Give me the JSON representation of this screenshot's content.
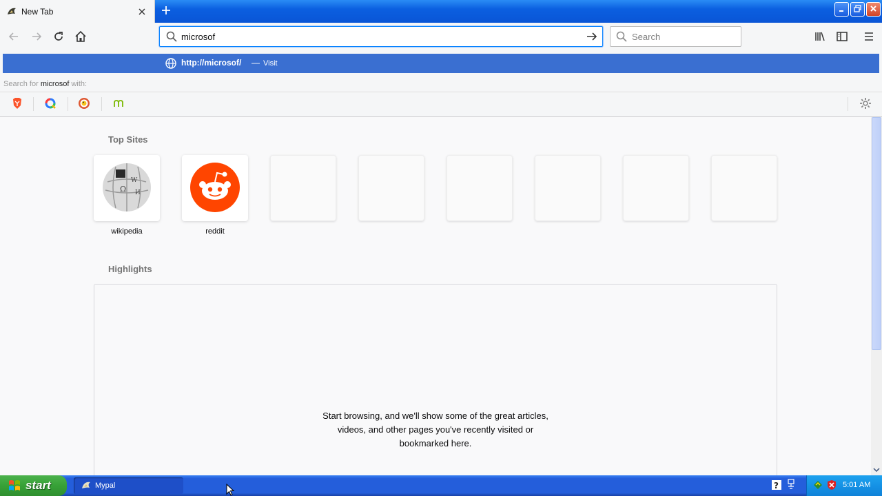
{
  "browser": {
    "tab": {
      "title": "New Tab",
      "favicon": "mypal-icon"
    },
    "new_tab_icon": "plus-icon",
    "window_controls": [
      "minimize-icon",
      "restore-icon",
      "close-icon"
    ]
  },
  "navbar": {
    "buttons": [
      "back-arrow-icon",
      "forward-arrow-icon",
      "reload-icon",
      "home-icon"
    ],
    "url_value": "microsof",
    "search_placeholder": "Search",
    "right_icons": [
      "library-icon",
      "sidebar-icon",
      "menu-icon"
    ]
  },
  "autocomplete": {
    "url": "http://microsof/",
    "separator": "—",
    "action": "Visit",
    "search_with_prefix": "Search for",
    "search_with_query": "microsof",
    "search_with_suffix": "with:",
    "engines": [
      "brave-engine-icon",
      "qwant-engine-icon",
      "duckduckgo-engine-icon",
      "mojeek-engine-icon"
    ]
  },
  "newtab": {
    "top_sites_title": "Top Sites",
    "top_sites": [
      {
        "label": "wikipedia",
        "icon": "wikipedia-globe-icon"
      },
      {
        "label": "reddit",
        "icon": "reddit-alien-icon"
      },
      {
        "label": ""
      },
      {
        "label": ""
      },
      {
        "label": ""
      },
      {
        "label": ""
      },
      {
        "label": ""
      },
      {
        "label": ""
      }
    ],
    "highlights_title": "Highlights",
    "highlights_message_1": "Start browsing, and we'll show some of the great articles,",
    "highlights_message_2": "videos, and other pages you've recently visited or",
    "highlights_message_3": "bookmarked here."
  },
  "taskbar": {
    "start_label": "start",
    "task_label": "Mypal",
    "clock": "5:01 AM"
  },
  "colors": {
    "accent": "#0a84ff",
    "autocomplete_highlight": "#3a6fd1",
    "reddit": "#ff4500",
    "taskbar": "#245edb",
    "start": "#37a137"
  }
}
